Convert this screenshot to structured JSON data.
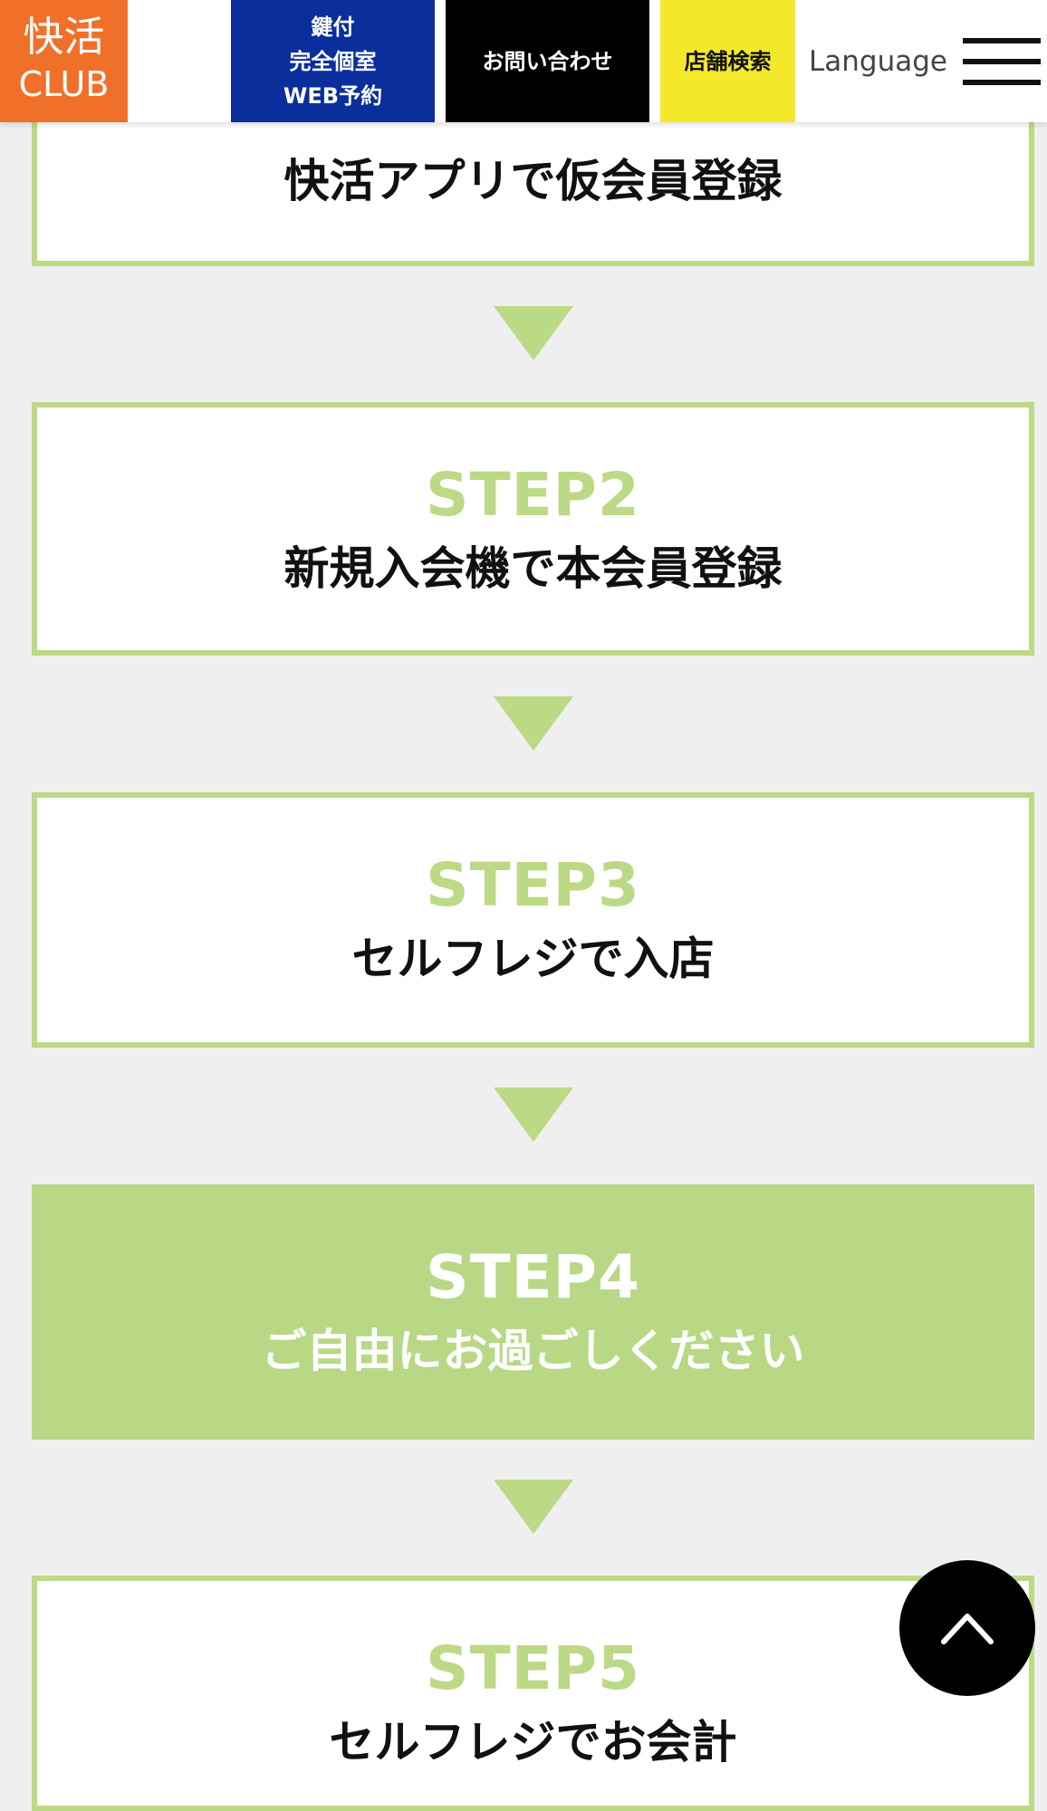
{
  "header": {
    "logo_main": "快活",
    "logo_sub": "CLUB",
    "reserve_line1": "鍵付",
    "reserve_line2": "完全個室",
    "reserve_line3": "WEB予約",
    "contact_label": "お問い合わせ",
    "store_label": "店舗検索",
    "language_label": "Language",
    "menu_icon": "hamburger-menu-icon"
  },
  "steps": [
    {
      "label": "",
      "title": "快活アプリで仮会員登録"
    },
    {
      "label": "STEP2",
      "title": "新規入会機で本会員登録"
    },
    {
      "label": "STEP3",
      "title": "セルフレジで入店"
    },
    {
      "label": "STEP4",
      "title": "ご自由にお過ごしください"
    },
    {
      "label": "STEP5",
      "title": "セルフレジでお会計"
    }
  ],
  "arrow_icon": "down-triangle-icon",
  "back_to_top_icon": "chevron-up-icon",
  "colors": {
    "logo_orange": "#f0702a",
    "reserve_blue": "#0a2f9c",
    "contact_black": "#000000",
    "store_yellow": "#f3e82a",
    "step_green": "#bcd986",
    "highlight_green": "#b8d885",
    "background": "#efefef"
  }
}
